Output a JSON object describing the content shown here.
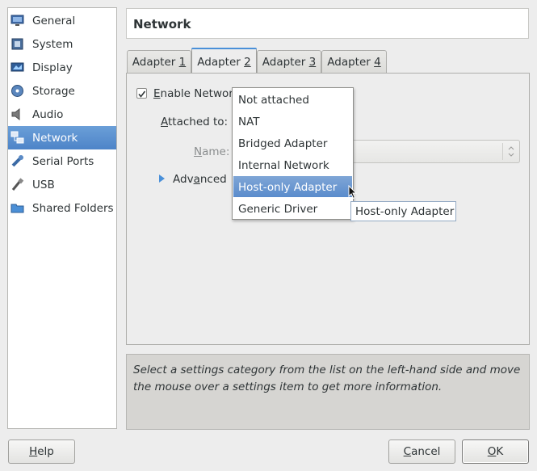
{
  "sidebar": {
    "items": [
      {
        "label": "General",
        "icon": "monitor-icon"
      },
      {
        "label": "System",
        "icon": "chip-icon"
      },
      {
        "label": "Display",
        "icon": "display-icon"
      },
      {
        "label": "Storage",
        "icon": "disk-icon"
      },
      {
        "label": "Audio",
        "icon": "speaker-icon"
      },
      {
        "label": "Network",
        "icon": "network-icon",
        "selected": true
      },
      {
        "label": "Serial Ports",
        "icon": "serial-port-icon"
      },
      {
        "label": "USB",
        "icon": "usb-icon"
      },
      {
        "label": "Shared Folders",
        "icon": "folder-icon"
      }
    ]
  },
  "header": {
    "title": "Network"
  },
  "tabs": [
    {
      "prefix": "Adapter ",
      "mnemonic": "1"
    },
    {
      "prefix": "Adapter ",
      "mnemonic": "2",
      "active": true
    },
    {
      "prefix": "Adapter ",
      "mnemonic": "3"
    },
    {
      "prefix": "Adapter ",
      "mnemonic": "4"
    }
  ],
  "form": {
    "enable_prefix": "",
    "enable_mnemonic": "E",
    "enable_rest": "nable Networ",
    "enable_checked": true,
    "attached_mnemonic": "A",
    "attached_rest": "ttached to:",
    "name_mnemonic": "N",
    "name_rest": "ame:",
    "advanced_prefix": "Adv",
    "advanced_mnemonic": "a",
    "advanced_rest": "nced"
  },
  "dropdown": {
    "options": [
      "Not attached",
      "NAT",
      "Bridged Adapter",
      "Internal Network",
      "Host-only Adapter",
      "Generic Driver"
    ],
    "selected": "Host-only Adapter"
  },
  "tooltip": "Host-only Adapter",
  "info": {
    "line1": "Select a settings category from the list on the left-hand side and move",
    "line2": "the mouse over a settings item to get more information."
  },
  "buttons": {
    "help_mnemonic": "H",
    "help_rest": "elp",
    "cancel_mnemonic": "C",
    "cancel_rest": "ancel",
    "ok_mnemonic": "O",
    "ok_rest": "K"
  },
  "colors": {
    "accent": "#4a90d9",
    "selection": "#5a8ccc"
  }
}
